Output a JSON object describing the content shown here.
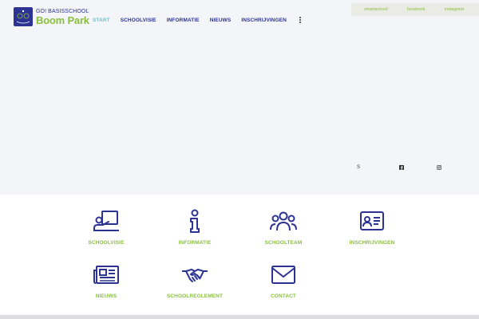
{
  "logo": {
    "line1": "GO! BASISSCHOOL",
    "line2": "Boom Park"
  },
  "nav": {
    "items": [
      {
        "label": "START",
        "active": true
      },
      {
        "label": "SCHOOLVISIE"
      },
      {
        "label": "INFORMATIE"
      },
      {
        "label": "NIEUWS"
      },
      {
        "label": "INSCHRIJVINGEN"
      }
    ]
  },
  "social_bar": {
    "smartschool": "smartschool",
    "facebook": "facebook",
    "instagram": "instagram"
  },
  "social_icons": {
    "smartschool": "S",
    "facebook_icon": "facebook-square-icon",
    "instagram_icon": "instagram-icon"
  },
  "tiles": [
    {
      "label": "SCHOOLVISIE",
      "icon": "teacher-board-icon"
    },
    {
      "label": "INFORMATIE",
      "icon": "info-icon"
    },
    {
      "label": "SCHOOLTEAM",
      "icon": "team-icon"
    },
    {
      "label": "INSCHRIJVINGEN",
      "icon": "id-card-icon"
    },
    {
      "label": "NIEUWS",
      "icon": "newspaper-icon"
    },
    {
      "label": "SCHOOLREGLEMENT",
      "icon": "handshake-icon"
    },
    {
      "label": "CONTACT",
      "icon": "envelope-icon"
    }
  ],
  "colors": {
    "brand_blue": "#2d3392",
    "brand_green": "#8bbf3f",
    "active_nav": "#6ec0c8",
    "hero_bg": "#f4f5f8"
  }
}
